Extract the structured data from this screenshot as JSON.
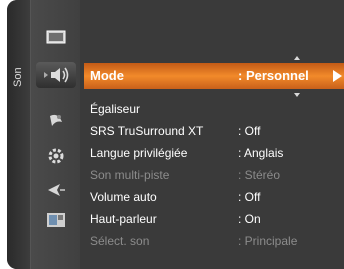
{
  "sidebar": {
    "category_label": "Son"
  },
  "icons": [
    "picture-icon",
    "sound-icon",
    "channel-icon",
    "setup-icon",
    "input-icon",
    "application-icon"
  ],
  "menu": {
    "items": [
      {
        "label": "Mode",
        "value": ": Personnel"
      },
      {
        "label": "Égaliseur",
        "value": ""
      },
      {
        "label": "SRS TruSurround XT",
        "value": ": Off"
      },
      {
        "label": "Langue privilégiée",
        "value": ": Anglais"
      },
      {
        "label": "Son multi-piste",
        "value": ": Stéréo"
      },
      {
        "label": "Volume auto",
        "value": ": Off"
      },
      {
        "label": "Haut-parleur",
        "value": ": On"
      },
      {
        "label": "Sélect. son",
        "value": ": Principale"
      }
    ]
  },
  "colors": {
    "highlight": "#f28a2a",
    "background": "#3a3a3a",
    "disabled_text": "#8c8c8c"
  }
}
